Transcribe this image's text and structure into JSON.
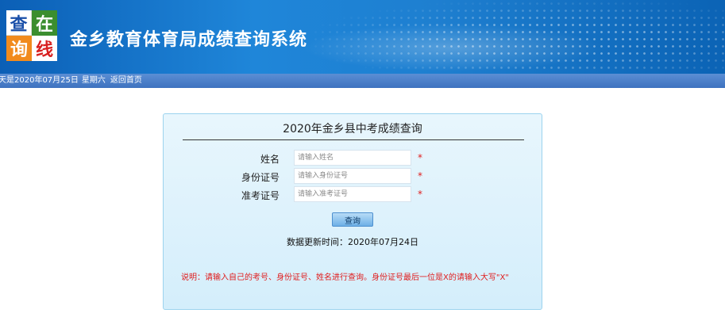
{
  "header": {
    "logo_chars": [
      "查",
      "在",
      "询",
      "线"
    ],
    "site_title": "金乡教育体育局成绩查询系统"
  },
  "statusbar": {
    "today": "天是2020年07月25日",
    "weekday": "星期六",
    "home_link": "返回首页"
  },
  "form": {
    "title": "2020年金乡县中考成绩查询",
    "fields": [
      {
        "label": "姓名",
        "placeholder": "请输入姓名",
        "required_mark": "*"
      },
      {
        "label": "身份证号",
        "placeholder": "请输入身份证号",
        "required_mark": "*"
      },
      {
        "label": "准考证号",
        "placeholder": "请输入准考证号",
        "required_mark": "*"
      }
    ],
    "submit_label": "查询",
    "update_text": "数据更新时间：2020年07月24日",
    "note": "说明：请输入自己的考号、身份证号、姓名进行查询。身份证号最后一位是X的请输入大写\"X\""
  },
  "colors": {
    "banner": "#1f86d9",
    "statusbar": "#4a7fc8",
    "panel_bg": "#dff2fc",
    "panel_border": "#9cd3ee",
    "required": "#e02020",
    "note": "#e01c1c"
  }
}
